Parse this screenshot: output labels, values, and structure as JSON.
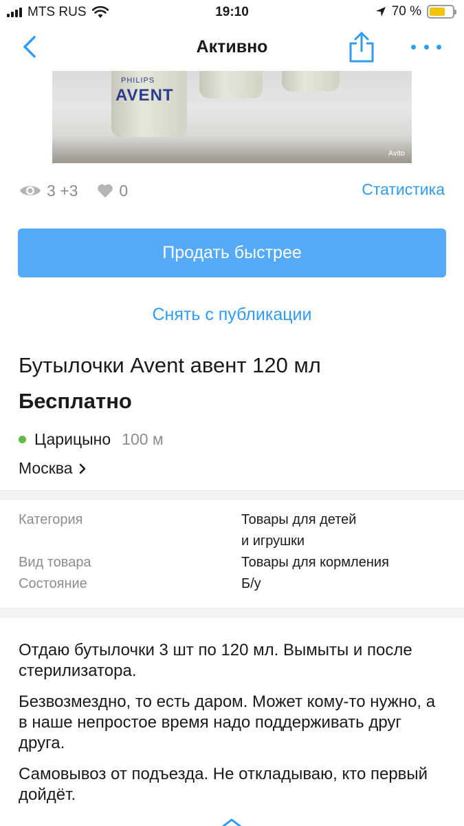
{
  "status_bar": {
    "carrier": "MTS RUS",
    "time": "19:10",
    "battery": "70 %",
    "battery_level": 0.7,
    "battery_color": "#f5c400"
  },
  "nav": {
    "title": "Активно",
    "back_icon": "chevron-left-icon",
    "share_icon": "share-icon",
    "more_icon": "more-dots-icon"
  },
  "photo": {
    "brand_line1": "PHILIPS",
    "brand_line2": "AVENT",
    "watermark": "Avito"
  },
  "stats": {
    "views": "3 +3",
    "likes": "0",
    "link": "Статистика"
  },
  "actions": {
    "sell_faster": "Продать быстрее",
    "unpublish": "Снять с публикации"
  },
  "item": {
    "title": "Бутылочки Avent авент 120 мл",
    "price": "Бесплатно",
    "metro": "Царицыно",
    "metro_distance": "100 м",
    "metro_color": "#5fba46",
    "city": "Москва"
  },
  "params": [
    {
      "label": "Категория",
      "value_line1": "Товары для детей",
      "value_line2": "и игрушки"
    },
    {
      "label": "Вид товара",
      "value_line1": "Товары для кормления"
    },
    {
      "label": "Состояние",
      "value_line1": "Б/у"
    }
  ],
  "description": [
    "Отдаю бутылочки 3 шт по 120 мл. Вымыты и после стерилизатора.",
    "Безвозмездно, то есть даром. Может кому-то нужно, а в наше непростое время надо поддерживать друг друга.",
    "Самовывоз от подъезда. Не откладываю, кто первый дойдёт."
  ],
  "colors": {
    "accent": "#2f9bf3",
    "primary_button": "#54aaf7"
  }
}
